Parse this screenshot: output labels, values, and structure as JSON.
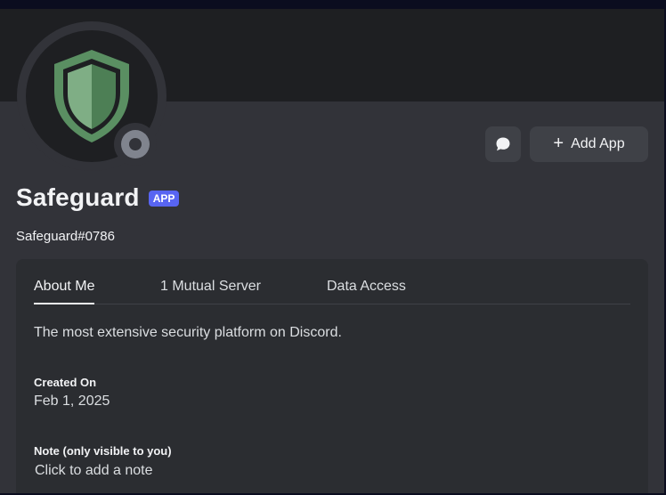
{
  "profile": {
    "display_name": "Safeguard",
    "badge": "APP",
    "username": "Safeguard#0786",
    "status": "offline"
  },
  "actions": {
    "message_icon": "chat-bubble-icon",
    "add_app_label": "Add App",
    "add_icon": "plus-icon"
  },
  "tabs": [
    {
      "label": "About Me",
      "active": true
    },
    {
      "label": "1 Mutual Server",
      "active": false
    },
    {
      "label": "Data Access",
      "active": false
    }
  ],
  "about": {
    "bio": "The most extensive security platform on Discord.",
    "created_label": "Created On",
    "created_value": "Feb 1, 2025",
    "note_label": "Note (only visible to you)",
    "note_placeholder": "Click to add a note"
  },
  "colors": {
    "badge": "#5865f2",
    "shield_light": "#7fae85",
    "shield_dark": "#4d7f55"
  }
}
